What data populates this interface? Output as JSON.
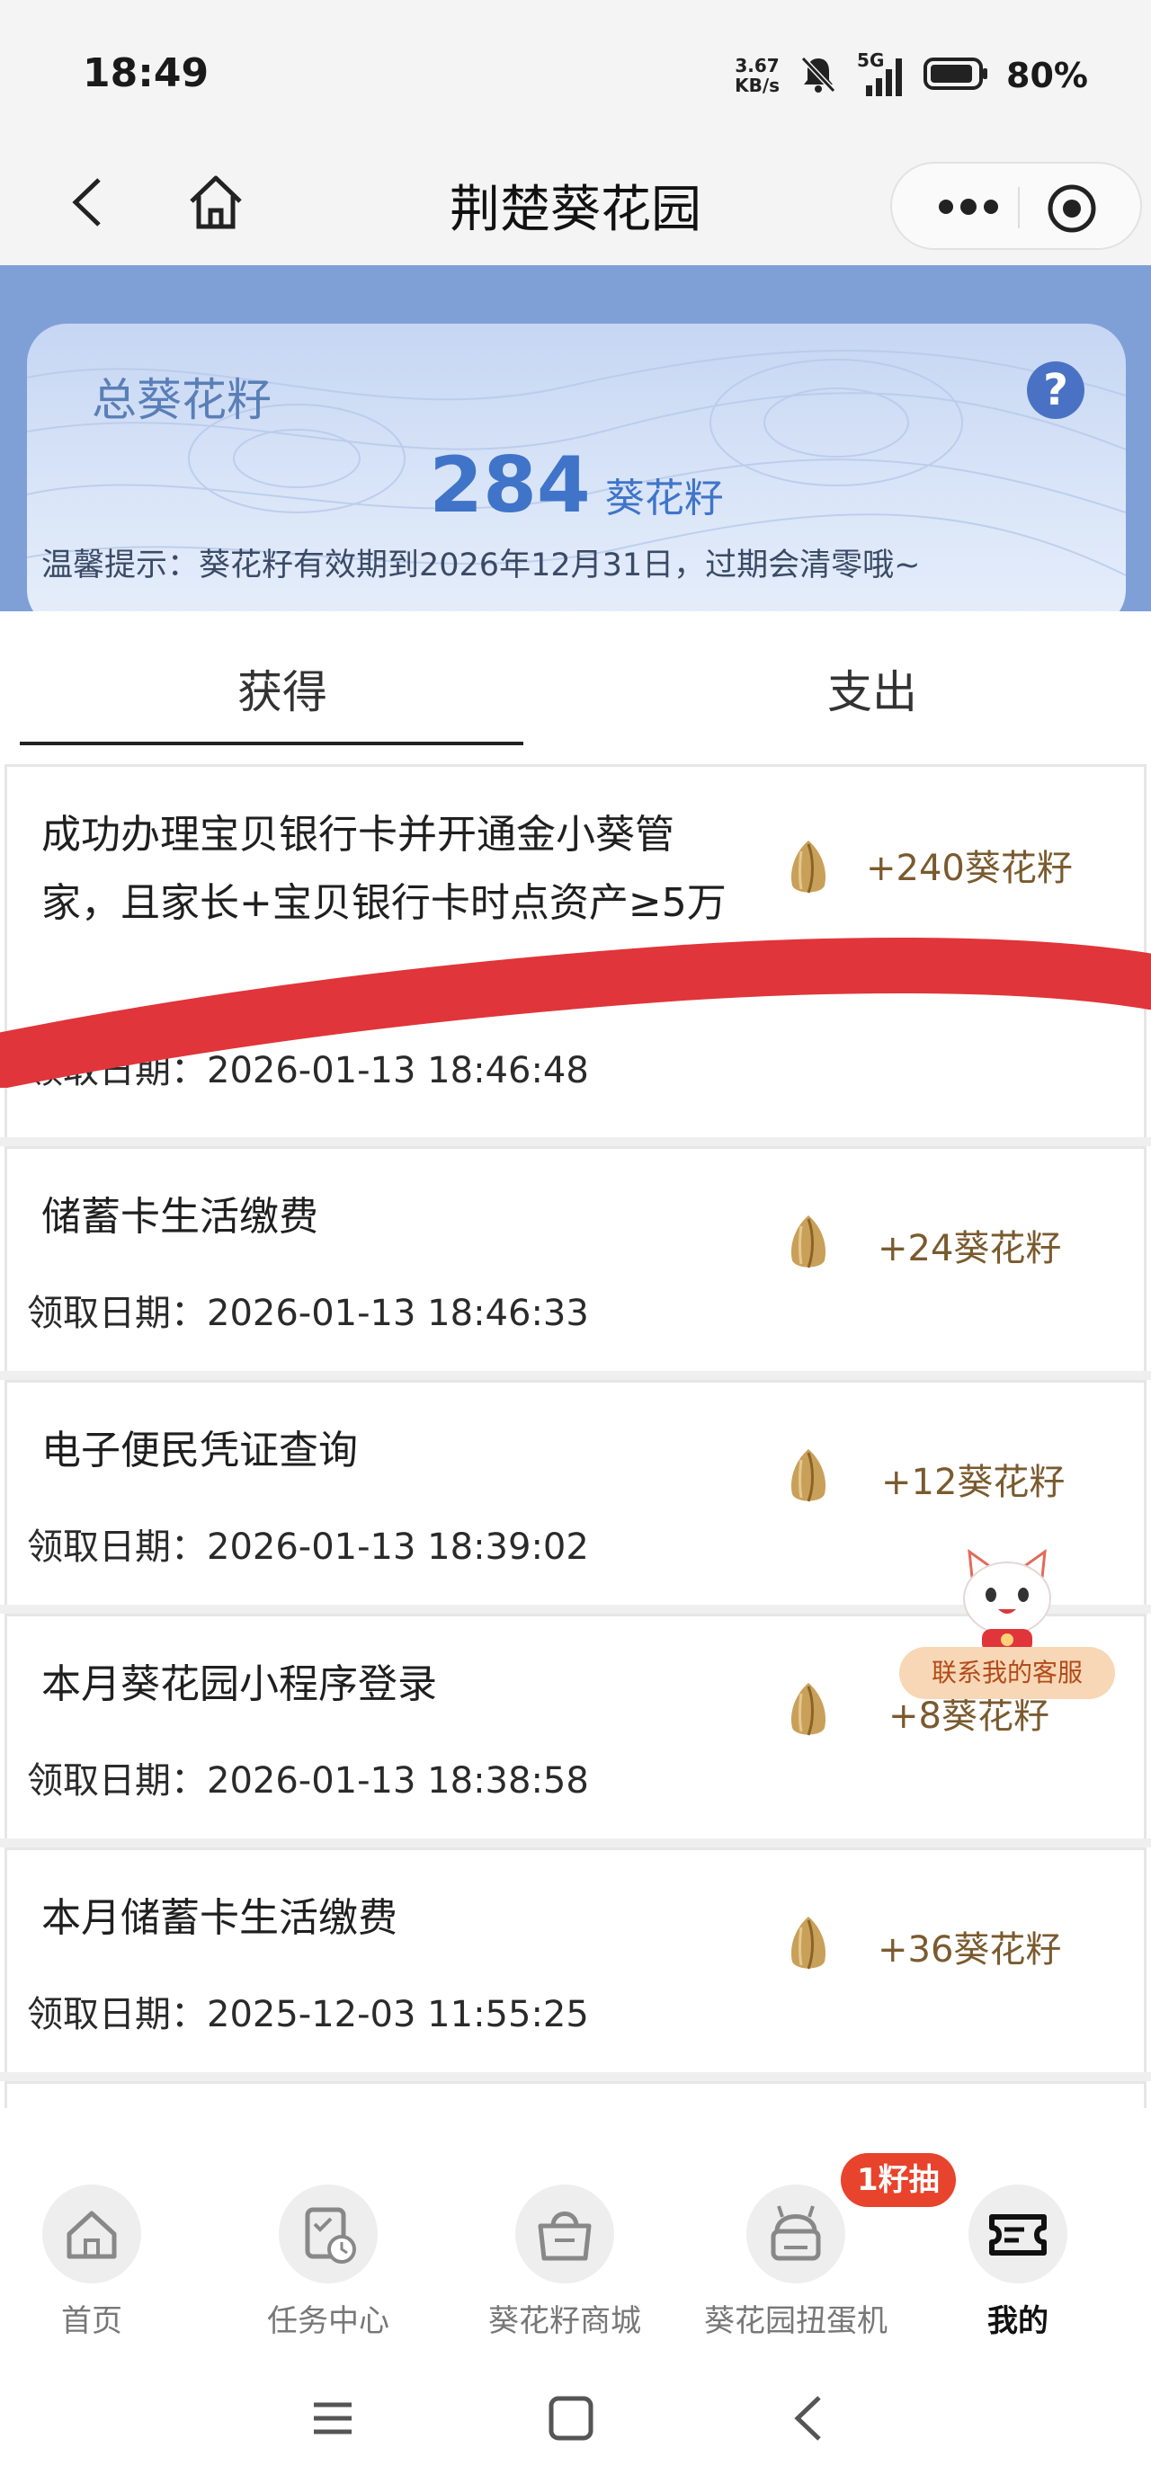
{
  "status_bar": {
    "time": "18:49",
    "net_speed_value": "3.67",
    "net_speed_unit": "KB/s",
    "signal_label": "5G",
    "battery": "80%"
  },
  "navbar": {
    "title": "荆楚葵花园"
  },
  "hero": {
    "label": "总葵花籽",
    "points": "284",
    "unit": "葵花籽",
    "tip": "温馨提示：葵花籽有效期到2026年12月31日，过期会清零哦~",
    "help": "?"
  },
  "tabs": {
    "earn": "获得",
    "spend": "支出"
  },
  "records": [
    {
      "title": "成功办理宝贝银行卡并开通金小葵管家，且家长+宝贝银行卡时点资产≥5万",
      "date": "领取日期：2026-01-13 18:46:48",
      "amount": "+240葵花籽"
    },
    {
      "title": "储蓄卡生活缴费",
      "date": "领取日期：2026-01-13 18:46:33",
      "amount": "+24葵花籽"
    },
    {
      "title": "电子便民凭证查询",
      "date": "领取日期：2026-01-13 18:39:02",
      "amount": "+12葵花籽"
    },
    {
      "title": "本月葵花园小程序登录",
      "date": "领取日期：2026-01-13 18:38:58",
      "amount": "+8葵花籽"
    },
    {
      "title": "本月储蓄卡生活缴费",
      "date": "领取日期：2025-12-03 11:55:25",
      "amount": "+36葵花籽"
    }
  ],
  "customer_service": {
    "label": "联系我的客服"
  },
  "tabbar": {
    "badge": "1籽抽",
    "items": [
      {
        "label": "首页",
        "icon": "home-icon"
      },
      {
        "label": "任务中心",
        "icon": "task-icon"
      },
      {
        "label": "葵花籽商城",
        "icon": "shop-icon"
      },
      {
        "label": "葵花园扭蛋机",
        "icon": "gacha-icon"
      },
      {
        "label": "我的",
        "icon": "ticket-icon"
      }
    ],
    "active_index": 4
  },
  "colors": {
    "accent_blue": "#3f74c9",
    "amount_brown": "#7a5a2e",
    "badge_red": "#e8432c",
    "scribble_red": "#e0353a"
  }
}
